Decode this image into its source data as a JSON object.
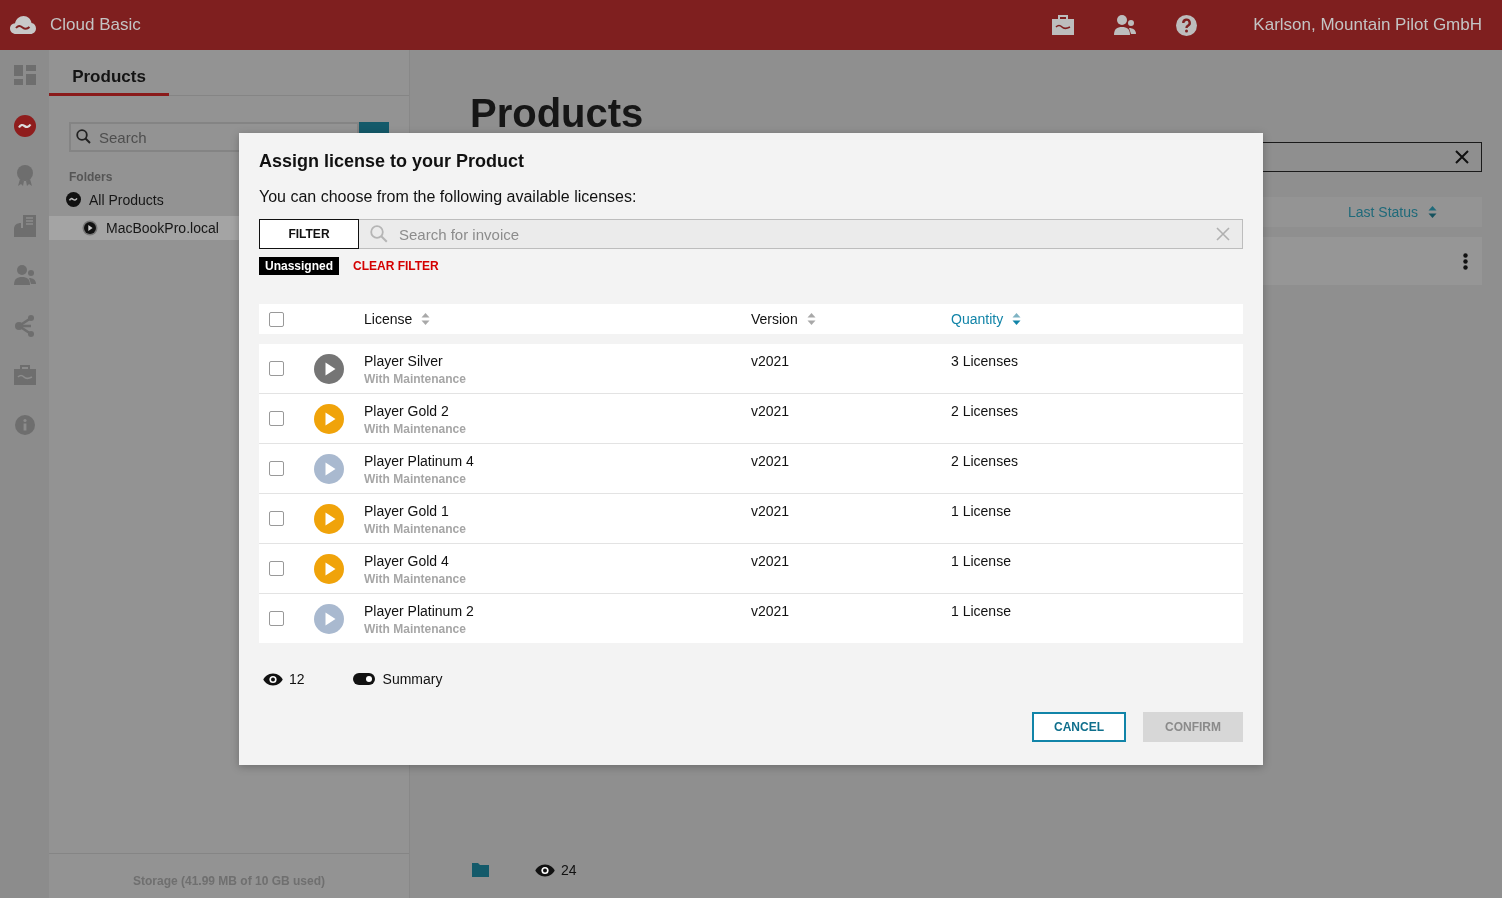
{
  "header": {
    "app_name": "Cloud Basic",
    "user": "Karlson, Mountain Pilot GmbH"
  },
  "rail": [
    {
      "kind": "dashboard",
      "selected": false
    },
    {
      "kind": "products",
      "selected": true
    },
    {
      "kind": "award",
      "selected": false
    },
    {
      "kind": "documents",
      "selected": false
    },
    {
      "kind": "users",
      "selected": false
    },
    {
      "kind": "share",
      "selected": false
    },
    {
      "kind": "briefcase",
      "selected": false
    },
    {
      "kind": "info",
      "selected": false
    }
  ],
  "side_panel": {
    "tab": "Products",
    "search": {
      "placeholder": "Search"
    },
    "folders_label": "Folders",
    "tree": [
      {
        "label": "All Products",
        "selected": false,
        "children": [
          {
            "label": "MacBookPro.local",
            "selected": true
          }
        ]
      }
    ],
    "storage": "Storage (41.99 MB of 10 GB used)"
  },
  "main": {
    "title": "Products",
    "columns": [
      {
        "label": "Last Status",
        "sorted": true
      }
    ],
    "count": "24"
  },
  "dialog": {
    "title": "Assign license to your Product",
    "subtitle": "You can choose from the following available licenses:",
    "filter_button": "FILTER",
    "search": {
      "placeholder": "Search for invoice"
    },
    "tags": [
      {
        "label": "Unassigned"
      }
    ],
    "clear_filter": "CLEAR FILTER",
    "select_all": {
      "checked": false
    },
    "columns": [
      {
        "label": "License",
        "sorted": false
      },
      {
        "label": "Version",
        "sorted": false
      },
      {
        "label": "Quantity",
        "sorted": true
      }
    ],
    "rows": [
      {
        "name": "Player Silver",
        "subtitle": "With Maintenance",
        "version": "v2021",
        "quantity": "3 Licenses",
        "color": "#757575",
        "checked": false
      },
      {
        "name": "Player Gold 2",
        "subtitle": "With Maintenance",
        "version": "v2021",
        "quantity": "2 Licenses",
        "color": "#f0a30a",
        "checked": false
      },
      {
        "name": "Player Platinum 4",
        "subtitle": "With Maintenance",
        "version": "v2021",
        "quantity": "2 Licenses",
        "color": "#a9b9cf",
        "checked": false
      },
      {
        "name": "Player Gold 1",
        "subtitle": "With Maintenance",
        "version": "v2021",
        "quantity": "1 License",
        "color": "#f0a30a",
        "checked": false
      },
      {
        "name": "Player Gold 4",
        "subtitle": "With Maintenance",
        "version": "v2021",
        "quantity": "1 License",
        "color": "#f0a30a",
        "checked": false
      },
      {
        "name": "Player Platinum 2",
        "subtitle": "With Maintenance",
        "version": "v2021",
        "quantity": "1 License",
        "color": "#a9b9cf",
        "checked": false
      }
    ],
    "count": "12",
    "summary": {
      "label": "Summary",
      "on": true
    },
    "buttons": [
      {
        "label": "CANCEL",
        "disabled": false
      },
      {
        "label": "CONFIRM",
        "disabled": true
      }
    ]
  }
}
